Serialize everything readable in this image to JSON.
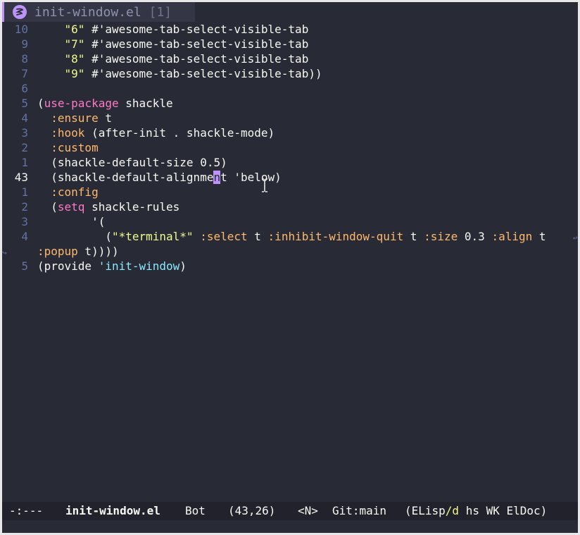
{
  "tab": {
    "icon": "emacs-icon",
    "title": "init-window.el",
    "number": "[1]"
  },
  "lines": [
    {
      "num": "10",
      "indent": "    ",
      "parts": [
        {
          "t": "\"6\"",
          "c": "str"
        },
        {
          "t": " #'awesome-tab-select-visible-tab",
          "c": ""
        }
      ]
    },
    {
      "num": "9",
      "indent": "    ",
      "parts": [
        {
          "t": "\"7\"",
          "c": "str"
        },
        {
          "t": " #'awesome-tab-select-visible-tab",
          "c": ""
        }
      ]
    },
    {
      "num": "8",
      "indent": "    ",
      "parts": [
        {
          "t": "\"8\"",
          "c": "str"
        },
        {
          "t": " #'awesome-tab-select-visible-tab",
          "c": ""
        }
      ]
    },
    {
      "num": "7",
      "indent": "    ",
      "parts": [
        {
          "t": "\"9\"",
          "c": "str"
        },
        {
          "t": " #'awesome-tab-select-visible-tab))",
          "c": ""
        }
      ]
    },
    {
      "num": "6",
      "indent": "",
      "parts": []
    },
    {
      "num": "5",
      "indent": "",
      "parts": [
        {
          "t": "(",
          "c": ""
        },
        {
          "t": "use-package",
          "c": "kw"
        },
        {
          "t": " shackle",
          "c": ""
        }
      ]
    },
    {
      "num": "4",
      "indent": "  ",
      "parts": [
        {
          "t": ":ensure",
          "c": "kwd"
        },
        {
          "t": " t",
          "c": ""
        }
      ]
    },
    {
      "num": "3",
      "indent": "  ",
      "parts": [
        {
          "t": ":hook",
          "c": "kwd"
        },
        {
          "t": " (after-init . shackle-mode)",
          "c": ""
        }
      ]
    },
    {
      "num": "2",
      "indent": "  ",
      "parts": [
        {
          "t": ":custom",
          "c": "kwd"
        }
      ]
    },
    {
      "num": "1",
      "indent": "  ",
      "parts": [
        {
          "t": "(shackle-default-size 0.5)",
          "c": ""
        }
      ]
    },
    {
      "num": "43",
      "indent": "  ",
      "current": true,
      "parts": [
        {
          "t": "(shackle-default-alignme",
          "c": ""
        },
        {
          "t": "n",
          "c": "cursor"
        },
        {
          "t": "t 'below)",
          "c": ""
        }
      ]
    },
    {
      "num": "1",
      "indent": "  ",
      "parts": [
        {
          "t": ":config",
          "c": "kwd"
        }
      ]
    },
    {
      "num": "2",
      "indent": "  ",
      "parts": [
        {
          "t": "(",
          "c": ""
        },
        {
          "t": "setq",
          "c": "kw"
        },
        {
          "t": " shackle-rules",
          "c": ""
        }
      ]
    },
    {
      "num": "3",
      "indent": "        ",
      "parts": [
        {
          "t": "'(",
          "c": ""
        }
      ]
    },
    {
      "num": "4",
      "indent": "          ",
      "parts": [
        {
          "t": "(",
          "c": ""
        },
        {
          "t": "\"*terminal*\"",
          "c": "str"
        },
        {
          "t": " ",
          "c": ""
        },
        {
          "t": ":select",
          "c": "kwd"
        },
        {
          "t": " t ",
          "c": ""
        },
        {
          "t": ":inhibit-window-quit",
          "c": "kwd"
        },
        {
          "t": " t ",
          "c": ""
        },
        {
          "t": ":size",
          "c": "kwd"
        },
        {
          "t": " 0.3 ",
          "c": ""
        },
        {
          "t": ":align",
          "c": "kwd"
        },
        {
          "t": " t",
          "c": ""
        }
      ]
    },
    {
      "num": "",
      "indent": "",
      "wrap": true,
      "parts": [
        {
          "t": ":popup",
          "c": "kwd"
        },
        {
          "t": " t))))",
          "c": ""
        }
      ]
    },
    {
      "num": "5",
      "indent": "",
      "parts": [
        {
          "t": "(provide ",
          "c": ""
        },
        {
          "t": "'init-window",
          "c": "sym"
        },
        {
          "t": ")",
          "c": ""
        }
      ]
    }
  ],
  "modeline": {
    "status": "-:---",
    "buffer": "init-window.el",
    "position": "Bot",
    "cursor_pos": "(43,26)",
    "evil_state": "<N>",
    "vc": "Git:main",
    "mode_open": "(ELisp",
    "mode_dir": "/d",
    "mode_rest": " hs WK ElDoc)"
  },
  "colors": {
    "background": "#282a36",
    "accent": "#bd93f9",
    "keyword": "#ff79c6",
    "builtin": "#ffb86c",
    "string": "#f1fa8c",
    "linenum": "#6272a4"
  }
}
